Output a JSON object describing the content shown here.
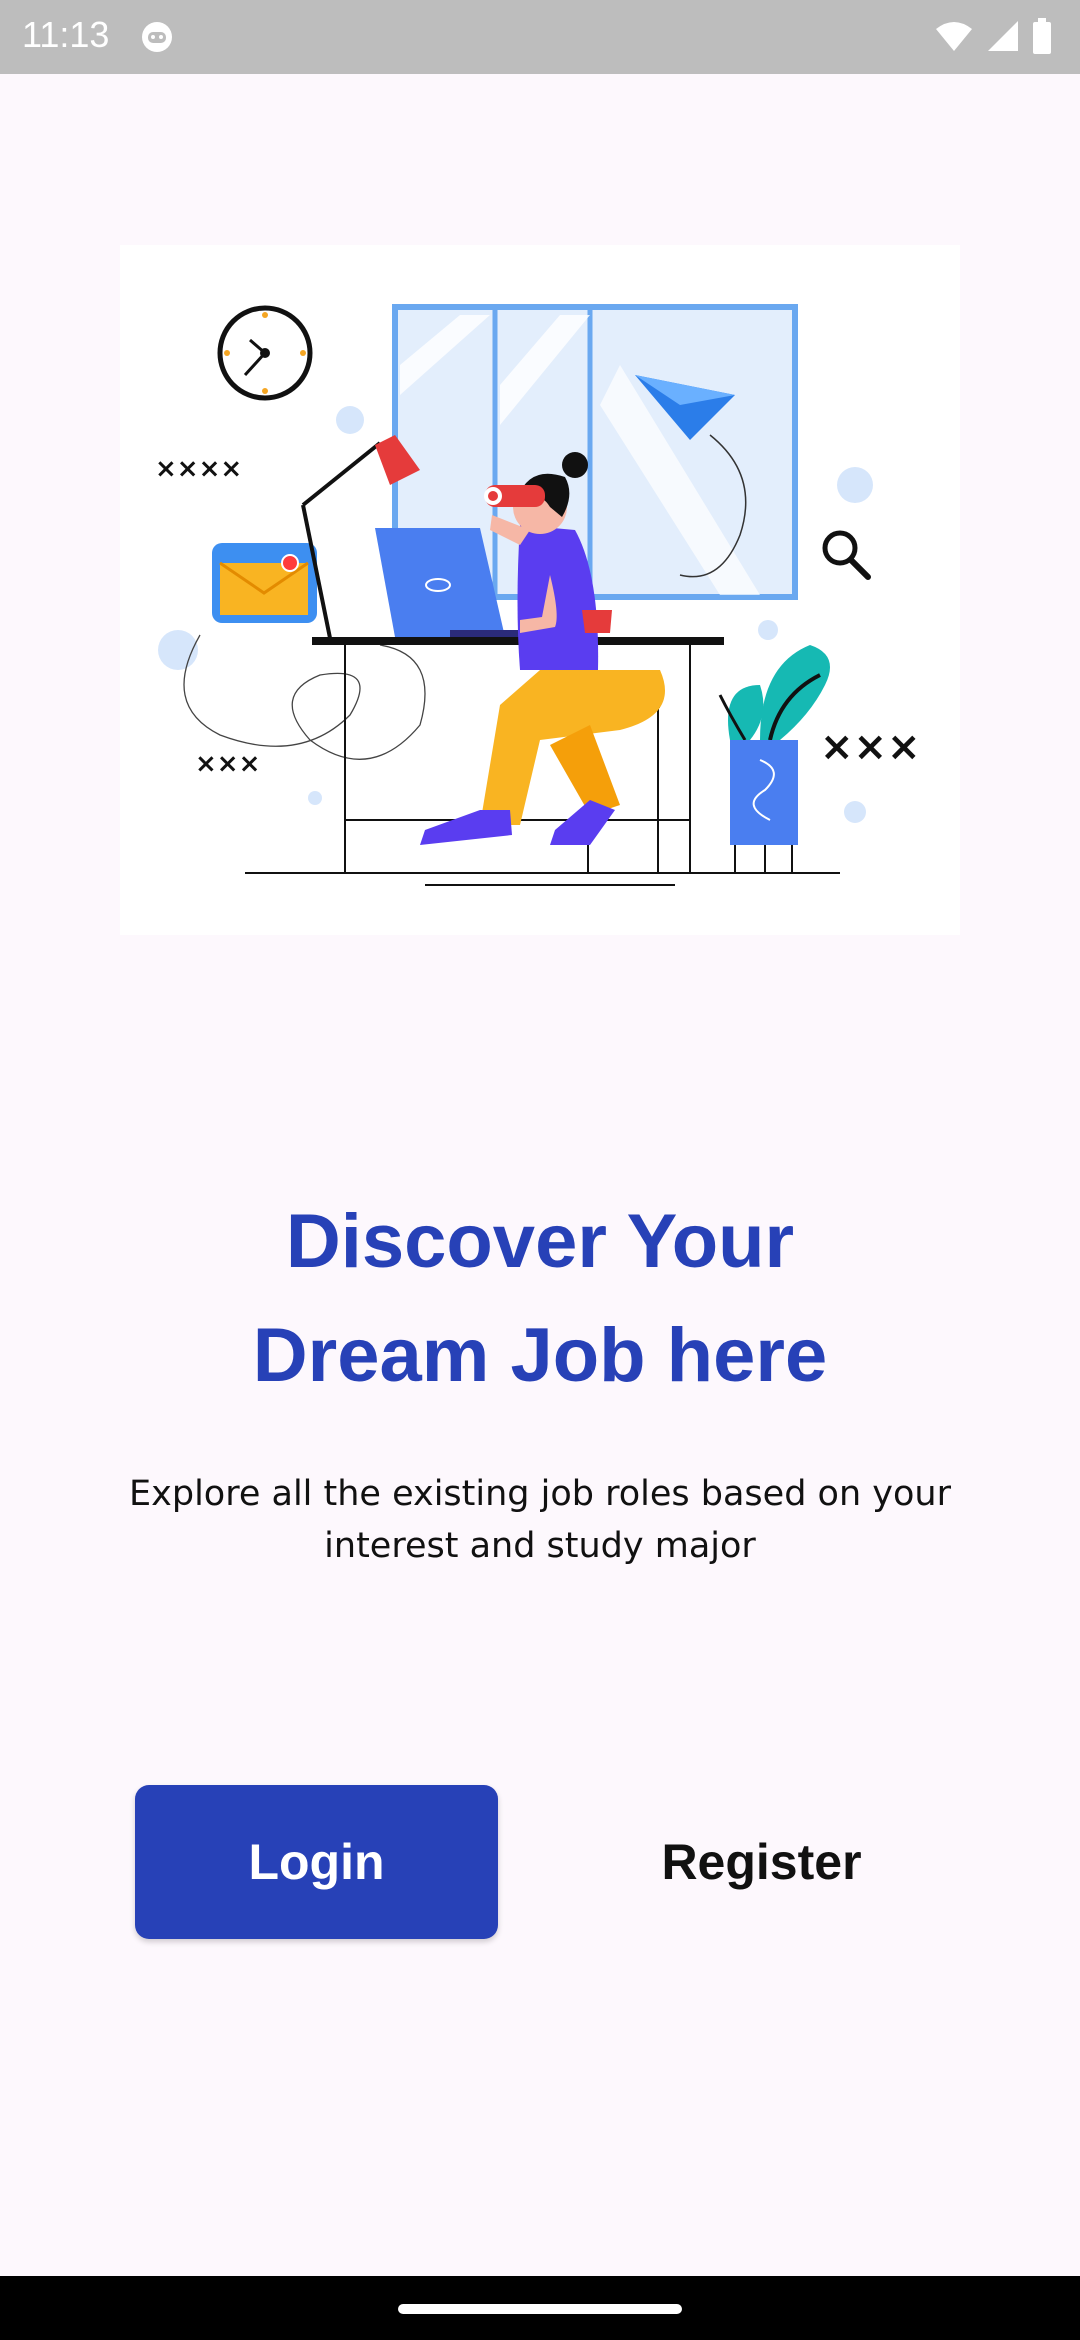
{
  "status_bar": {
    "time": "11:13",
    "icons": [
      "app-notification-icon",
      "wifi-icon",
      "signal-icon",
      "battery-icon"
    ],
    "background": "#bdbdbd"
  },
  "hero": {
    "illustration": "person-with-binoculars-at-desk-illustration"
  },
  "headline": {
    "line1": "Discover Your",
    "line2": "Dream Job here",
    "color": "#2741b7"
  },
  "subtext": {
    "line1": "Explore all the existing job roles based on your",
    "line2": "interest and study major"
  },
  "buttons": {
    "login_label": "Login",
    "register_label": "Register",
    "primary_color": "#2741b7"
  }
}
